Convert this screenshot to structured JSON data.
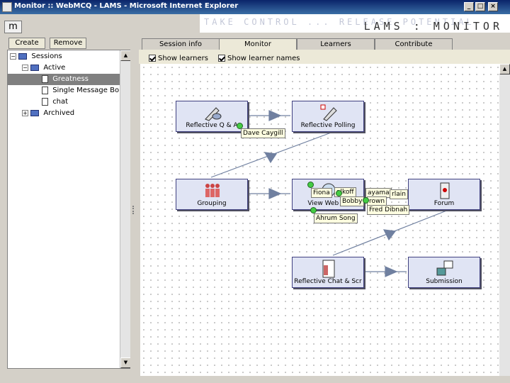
{
  "window": {
    "title": "Monitor :: WebMCQ - LAMS - Microsoft Internet Explorer",
    "controls": [
      "_",
      "□",
      "×"
    ]
  },
  "branding": {
    "tagline": "TAKE CONTROL ... RELEASE POTENTIAL",
    "app": "LAMS : MONITOR"
  },
  "toolbar": {
    "m_button": "m"
  },
  "sidebar": {
    "create_label": "Create",
    "remove_label": "Remove",
    "tree": {
      "root": "Sessions",
      "active": "Active",
      "items": [
        "Greatness",
        "Single Message Bo",
        "chat"
      ],
      "archived": "Archived"
    }
  },
  "tabs": [
    "Session info",
    "Monitor",
    "Learners",
    "Contribute"
  ],
  "active_tab": "Monitor",
  "options": {
    "show_learners": "Show learners",
    "show_learner_names": "Show learner names"
  },
  "activities": [
    {
      "label": "Reflective Q & A",
      "icon": "reflective-qa-icon"
    },
    {
      "label": "Reflective Polling",
      "icon": "reflective-polling-icon"
    },
    {
      "label": "Grouping",
      "icon": "grouping-icon"
    },
    {
      "label": "View Web Pa",
      "icon": "view-web-page-icon"
    },
    {
      "label": "Forum",
      "icon": "forum-icon"
    },
    {
      "label": "Reflective Chat & Scr",
      "icon": "reflective-chat-icon"
    },
    {
      "label": "Submission",
      "icon": "submission-icon"
    }
  ],
  "learners": [
    "Dave Caygill",
    "Fiona",
    "Falkoff",
    "Hayama",
    "Bobby Brown",
    "Chamberlain",
    "Fred Dibnah",
    "Ahrum Song"
  ],
  "learners_display": {
    "falkoff": "alkoff",
    "hayama": "ayama",
    "bobby": "Bobby",
    "brown": "rown",
    "chamberlain": "rlain"
  },
  "colors": {
    "titlebar": "#0a246a",
    "activity_fill": "#e0e4f4",
    "learner_dot": "#44cc44",
    "arrow": "#7080a0"
  }
}
